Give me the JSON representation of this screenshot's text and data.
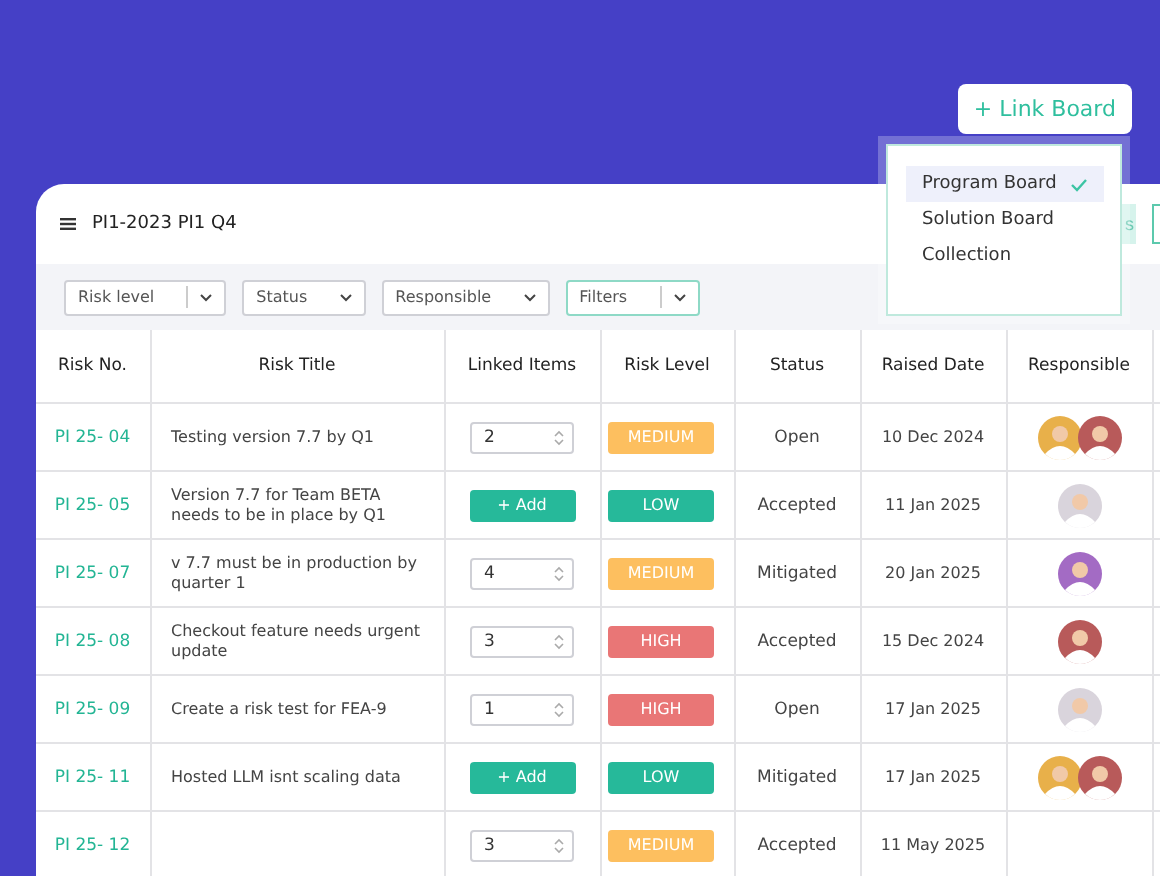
{
  "link_board_button": "+ Link Board",
  "board_menu": {
    "items": [
      {
        "label": "Program Board",
        "selected": true
      },
      {
        "label": "Solution Board",
        "selected": false
      },
      {
        "label": "Collection",
        "selected": false
      }
    ]
  },
  "header": {
    "title": "PI1-2023 PI1 Q4",
    "partial_button": "s"
  },
  "filters": [
    {
      "label": "Risk level",
      "split": true,
      "highlighted": false
    },
    {
      "label": "Status",
      "split": false,
      "highlighted": false
    },
    {
      "label": "Responsible",
      "split": false,
      "highlighted": false
    },
    {
      "label": "Filters",
      "split": true,
      "highlighted": true
    }
  ],
  "table": {
    "columns": [
      "Risk No.",
      "Risk Title",
      "Linked Items",
      "Risk Level",
      "Status",
      "Raised Date",
      "Responsible"
    ],
    "rows": [
      {
        "risk_no": "PI 25- 04",
        "title": "Testing version 7.7 by Q1",
        "linked": {
          "kind": "number",
          "value": "2"
        },
        "level": {
          "label": "MEDIUM",
          "color": "#fdbf5f"
        },
        "status": "Open",
        "date": "10 Dec 2024",
        "responsible": [
          {
            "color": "#e8b04a"
          },
          {
            "color": "#b85a5a"
          }
        ]
      },
      {
        "risk_no": "PI 25- 05",
        "title": "Version 7.7 for Team BETA needs to be in place by Q1",
        "linked": {
          "kind": "add",
          "label": "+ Add"
        },
        "level": {
          "label": "LOW",
          "color": "#26b99a"
        },
        "status": "Accepted",
        "date": "11 Jan 2025",
        "responsible": [
          {
            "color": "#d9d4dc"
          }
        ]
      },
      {
        "risk_no": "PI 25- 07",
        "title": "v 7.7 must be in production by quarter 1",
        "linked": {
          "kind": "number",
          "value": "4"
        },
        "level": {
          "label": "MEDIUM",
          "color": "#fdbf5f"
        },
        "status": "Mitigated",
        "date": "20 Jan 2025",
        "responsible": [
          {
            "color": "#a36bc4"
          }
        ]
      },
      {
        "risk_no": "PI 25- 08",
        "title": "Checkout feature needs urgent update",
        "linked": {
          "kind": "number",
          "value": "3"
        },
        "level": {
          "label": "HIGH",
          "color": "#e97676"
        },
        "status": "Accepted",
        "date": "15 Dec 2024",
        "responsible": [
          {
            "color": "#b85a5a"
          }
        ]
      },
      {
        "risk_no": "PI 25- 09",
        "title": "Create a risk test for FEA-9",
        "linked": {
          "kind": "number",
          "value": "1"
        },
        "level": {
          "label": "HIGH",
          "color": "#e97676"
        },
        "status": "Open",
        "date": "17 Jan 2025",
        "responsible": [
          {
            "color": "#d9d4dc"
          }
        ]
      },
      {
        "risk_no": "PI 25- 11",
        "title": "Hosted LLM isnt scaling data",
        "linked": {
          "kind": "add",
          "label": "+ Add"
        },
        "level": {
          "label": "LOW",
          "color": "#26b99a"
        },
        "status": "Mitigated",
        "date": "17 Jan 2025",
        "responsible": [
          {
            "color": "#e8b04a"
          },
          {
            "color": "#b85a5a"
          }
        ]
      },
      {
        "risk_no": "PI 25- 12",
        "linked": {
          "kind": "number",
          "value": "3"
        },
        "level": {
          "label": "MEDIUM",
          "color": "#fdbf5f"
        },
        "status": "Accepted",
        "date": "11 May 2025",
        "responsible": []
      }
    ]
  }
}
